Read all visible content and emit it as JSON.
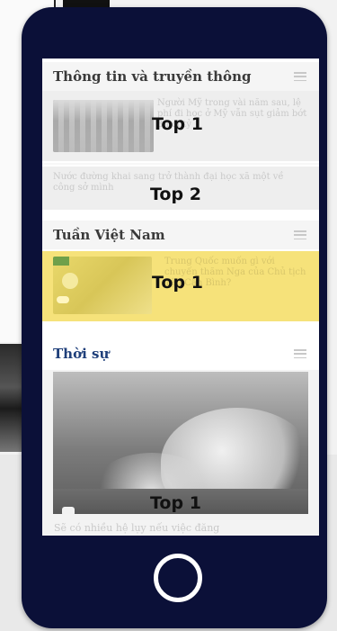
{
  "sections": [
    {
      "title": "Thông tin và truyền thông",
      "articles": [
        {
          "snippet": "Người Mỹ trong vài năm sau, lệ phí đi học ở Mỹ vẫn sụt giảm bớt 3 nơi tỷ",
          "badge": "Top 1"
        },
        {
          "snippet": "Nước đường khai sang trở thành đại học xã một về công sở mình",
          "badge": "Top 2"
        }
      ]
    },
    {
      "title": "Tuần Việt Nam",
      "articles": [
        {
          "snippet": "Trung Quốc muốn gì với chuyến thăm Nga của Chủ tịch Tập Cận Bình?",
          "badge": "Top 1"
        }
      ]
    },
    {
      "title": "Thời sự",
      "articles": [
        {
          "snippet": "Sẽ có nhiều hệ lụy nếu việc đăng",
          "badge": "Top 1"
        }
      ]
    }
  ],
  "icons": {
    "menu": "hamburger-menu-icon",
    "home": "home-button-icon",
    "camera": "camera-icon"
  },
  "colors": {
    "phone": "#0b1038",
    "highlight": "#f6e27a",
    "section_blue": "#1f3f7a"
  }
}
